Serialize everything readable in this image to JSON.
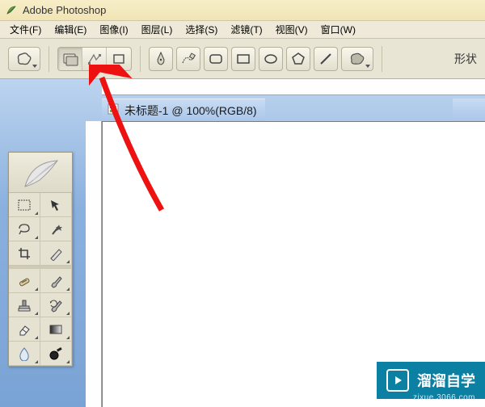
{
  "app": {
    "title": "Adobe Photoshop"
  },
  "menu": {
    "file": "文件(F)",
    "edit": "编辑(E)",
    "image": "图像(I)",
    "layer": "图层(L)",
    "select": "选择(S)",
    "filter": "滤镜(T)",
    "view": "视图(V)",
    "window": "窗口(W)"
  },
  "options": {
    "shape_label": "形状"
  },
  "document": {
    "title": "未标题-1 @ 100%(RGB/8)"
  },
  "watermark": {
    "brand": "溜溜自学",
    "url": "zixue.3066.com"
  },
  "icons": {
    "app": "app-feather-icon",
    "doc": "doc-icon"
  }
}
